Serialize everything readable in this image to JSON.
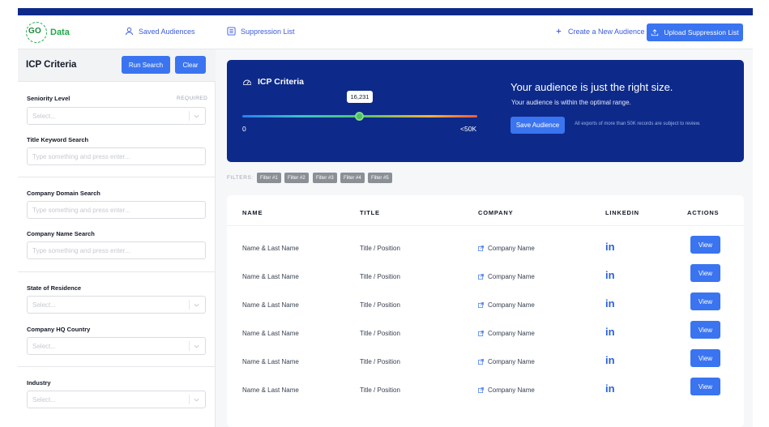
{
  "brand": {
    "logo_mark": "GO",
    "logo_text": "Data"
  },
  "nav": {
    "saved_audiences": "Saved Audiences",
    "suppression_list": "Suppression List",
    "create_audience": "Create a New Audience",
    "upload_suppression": "Upload Suppression List"
  },
  "sidebar": {
    "title": "ICP Criteria",
    "run_search": "Run Search",
    "clear": "Clear",
    "required": "REQUIRED",
    "fields": [
      {
        "label": "Seniority Level",
        "placeholder": "Select..."
      },
      {
        "label": "Title Keyword Search",
        "placeholder": "Type something and press enter..."
      },
      {
        "label": "Company Domain Search",
        "placeholder": "Type something and press enter..."
      },
      {
        "label": "Company Name Search",
        "placeholder": "Type something and press enter..."
      },
      {
        "label": "State of Residence",
        "placeholder": "Select..."
      },
      {
        "label": "Company HQ Country",
        "placeholder": "Select..."
      },
      {
        "label": "Industry",
        "placeholder": "Select..."
      }
    ]
  },
  "hero": {
    "title": "ICP Criteria",
    "slider_value": "16,231",
    "slider_level": 0.5,
    "slider_min": "0",
    "slider_max": "<50K",
    "headline": "Your audience is just the right size.",
    "subline": "Your audience is within the optimal range.",
    "save_button": "Save Audience",
    "note": "All exports of more than 50K records are subject to review."
  },
  "filters": {
    "label": "FILTERS:",
    "chips": [
      "Filter #1",
      "Filter #2",
      "Filter #3",
      "Filter #4",
      "Filter #5"
    ]
  },
  "table": {
    "headers": [
      "NAME",
      "TITLE",
      "COMPANY",
      "LINKEDIN",
      "ACTIONS"
    ],
    "linkedin_glyph": "in",
    "view_label": "View",
    "rows": [
      {
        "name": "Name & Last Name",
        "title": "Title / Position",
        "company": "Company Name"
      },
      {
        "name": "Name & Last Name",
        "title": "Title / Position",
        "company": "Company Name"
      },
      {
        "name": "Name & Last Name",
        "title": "Title / Position",
        "company": "Company Name"
      },
      {
        "name": "Name & Last Name",
        "title": "Title / Position",
        "company": "Company Name"
      },
      {
        "name": "Name & Last Name",
        "title": "Title / Position",
        "company": "Company Name"
      },
      {
        "name": "Name & Last Name",
        "title": "Title / Position",
        "company": "Company Name"
      }
    ]
  },
  "colors": {
    "primary": "#3a74f0",
    "navy": "#0d2a8a",
    "brand_green": "#22a84a",
    "linkedin": "#2a62d8"
  },
  "icons": [
    "user-icon",
    "list-icon",
    "plus-icon",
    "upload-icon",
    "gauge-icon",
    "chevron-down-icon",
    "external-link-icon",
    "linkedin-icon"
  ]
}
